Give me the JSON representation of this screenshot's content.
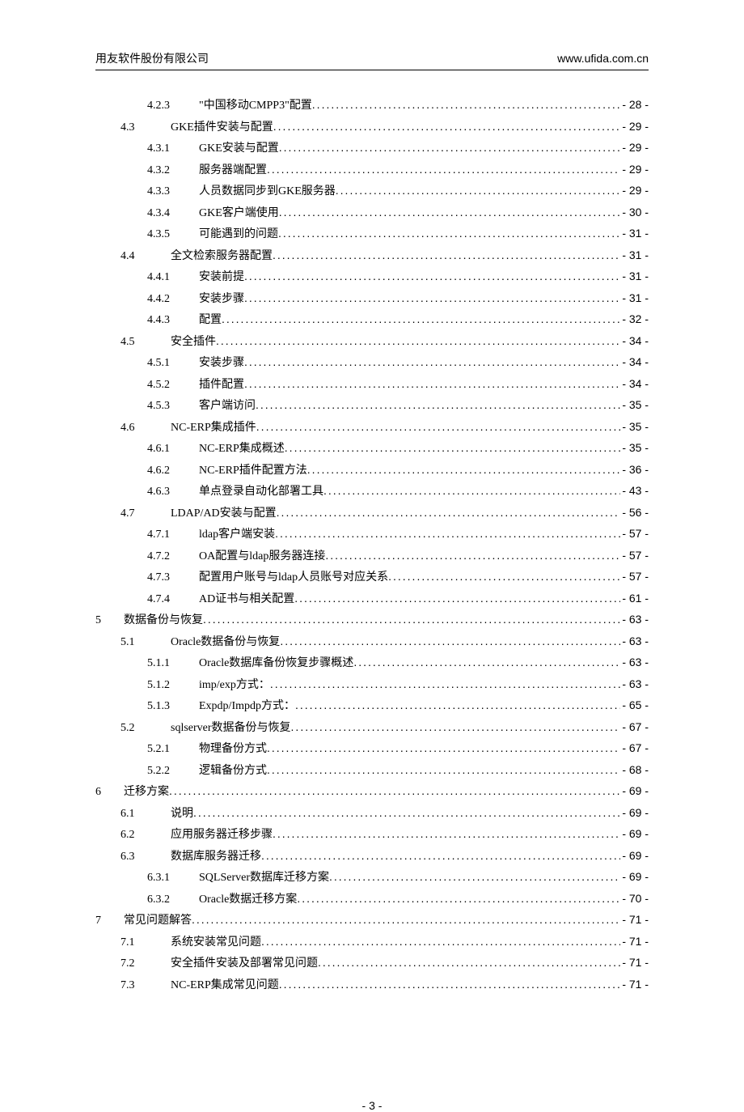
{
  "header": {
    "company": "用友软件股份有限公司",
    "url": "www.ufida.com.cn"
  },
  "toc": [
    {
      "level": 3,
      "num": "4.2.3",
      "title": "\"中国移动CMPP3\"配置",
      "page": "- 28 -"
    },
    {
      "level": 2,
      "num": "4.3",
      "title": "GKE插件安装与配置",
      "page": "- 29 -"
    },
    {
      "level": 3,
      "num": "4.3.1",
      "title": "GKE安装与配置",
      "page": "- 29 -"
    },
    {
      "level": 3,
      "num": "4.3.2",
      "title": "服务器端配置",
      "page": "- 29 -"
    },
    {
      "level": 3,
      "num": "4.3.3",
      "title": "人员数据同步到GKE服务器",
      "page": "- 29 -"
    },
    {
      "level": 3,
      "num": "4.3.4",
      "title": "GKE客户端使用",
      "page": "- 30 -"
    },
    {
      "level": 3,
      "num": "4.3.5",
      "title": "可能遇到的问题",
      "page": "- 31 -"
    },
    {
      "level": 2,
      "num": "4.4",
      "title": "全文检索服务器配置",
      "page": "- 31 -"
    },
    {
      "level": 3,
      "num": "4.4.1",
      "title": "安装前提",
      "page": "- 31 -"
    },
    {
      "level": 3,
      "num": "4.4.2",
      "title": "安装步骤",
      "page": "- 31 -"
    },
    {
      "level": 3,
      "num": "4.4.3",
      "title": "配置",
      "page": "- 32 -"
    },
    {
      "level": 2,
      "num": "4.5",
      "title": "安全插件",
      "page": "- 34 -"
    },
    {
      "level": 3,
      "num": "4.5.1",
      "title": "安装步骤",
      "page": "- 34 -"
    },
    {
      "level": 3,
      "num": "4.5.2",
      "title": "插件配置",
      "page": "- 34 -"
    },
    {
      "level": 3,
      "num": "4.5.3",
      "title": "客户端访问",
      "page": "- 35 -"
    },
    {
      "level": 2,
      "num": "4.6",
      "title": "NC-ERP集成插件",
      "page": "- 35 -"
    },
    {
      "level": 3,
      "num": "4.6.1",
      "title": "NC-ERP集成概述",
      "page": "- 35 -"
    },
    {
      "level": 3,
      "num": "4.6.2",
      "title": "NC-ERP插件配置方法",
      "page": "- 36 -"
    },
    {
      "level": 3,
      "num": "4.6.3",
      "title": "单点登录自动化部署工具",
      "page": "- 43 -"
    },
    {
      "level": 2,
      "num": "4.7",
      "title": "LDAP/AD安装与配置",
      "page": "- 56 -"
    },
    {
      "level": 3,
      "num": "4.7.1",
      "title": "ldap客户端安装",
      "page": "- 57 -"
    },
    {
      "level": 3,
      "num": "4.7.2",
      "title": "OA配置与ldap服务器连接",
      "page": "- 57 -"
    },
    {
      "level": 3,
      "num": "4.7.3",
      "title": "配置用户账号与ldap人员账号对应关系",
      "page": "- 57 -"
    },
    {
      "level": 3,
      "num": "4.7.4",
      "title": "AD证书与相关配置",
      "page": "- 61 -"
    },
    {
      "level": 1,
      "num": "5",
      "title": "数据备份与恢复",
      "page": "- 63 -"
    },
    {
      "level": 2,
      "num": "5.1",
      "title": "Oracle数据备份与恢复",
      "page": "- 63 -"
    },
    {
      "level": 3,
      "num": "5.1.1",
      "title": "Oracle数据库备份恢复步骤概述",
      "page": "- 63 -"
    },
    {
      "level": 3,
      "num": "5.1.2",
      "title": "imp/exp方式：",
      "page": "- 63 -"
    },
    {
      "level": 3,
      "num": "5.1.3",
      "title": "Expdp/Impdp方式：",
      "page": "- 65 -"
    },
    {
      "level": 2,
      "num": "5.2",
      "title": "sqlserver数据备份与恢复",
      "page": "- 67 -"
    },
    {
      "level": 3,
      "num": "5.2.1",
      "title": "物理备份方式",
      "page": "- 67 -"
    },
    {
      "level": 3,
      "num": "5.2.2",
      "title": "逻辑备份方式",
      "page": "- 68 -"
    },
    {
      "level": 1,
      "num": "6",
      "title": "迁移方案",
      "page": "- 69 -"
    },
    {
      "level": 2,
      "num": "6.1",
      "title": "说明",
      "page": "- 69 -"
    },
    {
      "level": 2,
      "num": "6.2",
      "title": "应用服务器迁移步骤",
      "page": "- 69 -"
    },
    {
      "level": 2,
      "num": "6.3",
      "title": "数据库服务器迁移",
      "page": "- 69 -"
    },
    {
      "level": 3,
      "num": "6.3.1",
      "title": "SQLServer数据库迁移方案",
      "page": "- 69 -"
    },
    {
      "level": 3,
      "num": "6.3.2",
      "title": "Oracle数据迁移方案",
      "page": "- 70 -"
    },
    {
      "level": 1,
      "num": "7",
      "title": "常见问题解答",
      "page": "- 71 -"
    },
    {
      "level": 2,
      "num": "7.1",
      "title": "系统安装常见问题",
      "page": "- 71 -"
    },
    {
      "level": 2,
      "num": "7.2",
      "title": "安全插件安装及部署常见问题",
      "page": "- 71 -"
    },
    {
      "level": 2,
      "num": "7.3",
      "title": "NC-ERP集成常见问题",
      "page": "- 71 -"
    }
  ],
  "footer": {
    "page_number": "- 3 -"
  }
}
